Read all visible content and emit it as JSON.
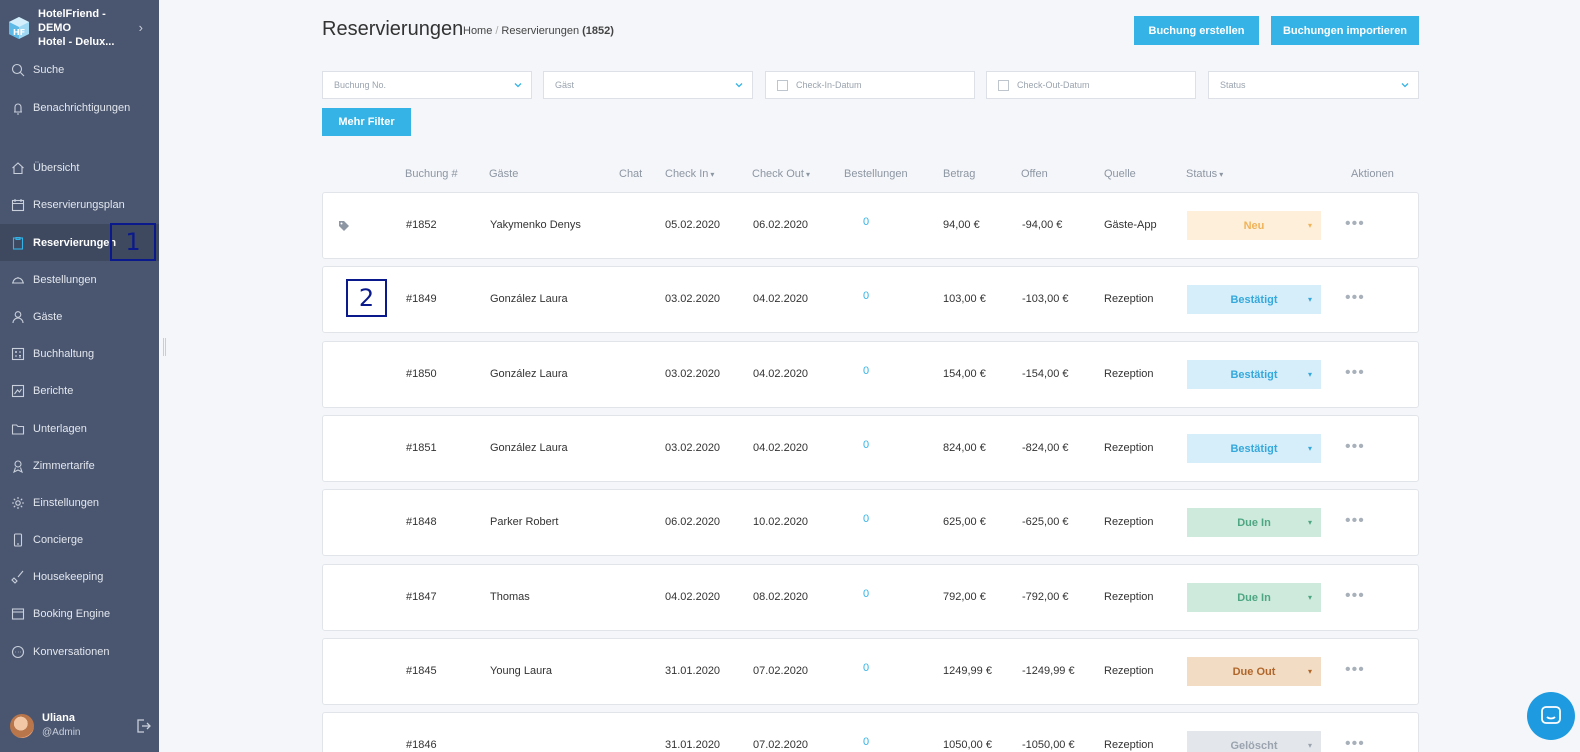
{
  "sidebar": {
    "hotel_line1": "HotelFriend - DEMO",
    "hotel_line2": "Hotel - Delux...",
    "items": [
      {
        "label": "Suche",
        "icon": "search-icon"
      },
      {
        "label": "Benachrichtigungen",
        "icon": "bell-icon"
      },
      {
        "label": "Übersicht",
        "icon": "home-icon"
      },
      {
        "label": "Reservierungsplan",
        "icon": "calendar-icon"
      },
      {
        "label": "Reservierungen",
        "icon": "clipboard-icon",
        "active": true
      },
      {
        "label": "Bestellungen",
        "icon": "cloche-icon"
      },
      {
        "label": "Gäste",
        "icon": "user-icon"
      },
      {
        "label": "Buchhaltung",
        "icon": "calculator-icon"
      },
      {
        "label": "Berichte",
        "icon": "chart-icon"
      },
      {
        "label": "Unterlagen",
        "icon": "folder-icon"
      },
      {
        "label": "Zimmertarife",
        "icon": "tariff-icon"
      },
      {
        "label": "Einstellungen",
        "icon": "gear-icon"
      },
      {
        "label": "Concierge",
        "icon": "phone-icon"
      },
      {
        "label": "Housekeeping",
        "icon": "broom-icon"
      },
      {
        "label": "Booking Engine",
        "icon": "browser-icon"
      },
      {
        "label": "Konversationen",
        "icon": "chat-icon"
      }
    ],
    "user": {
      "name": "Uliana",
      "role": "@Admin"
    }
  },
  "annotations": {
    "one": "1",
    "two": "2"
  },
  "header": {
    "title": "Reservierungen",
    "breadcrumb_home": "Home",
    "breadcrumb_current": "Reservierungen",
    "breadcrumb_count": "(1852)",
    "create_button": "Buchung erstellen",
    "import_button": "Buchungen importieren"
  },
  "filters": {
    "booking_no": "Buchung No.",
    "guest": "Gäst",
    "check_in": "Check-In-Datum",
    "check_out": "Check-Out-Datum",
    "status": "Status",
    "more_button": "Mehr Filter"
  },
  "table": {
    "columns": {
      "booking": "Buchung #",
      "guests": "Gäste",
      "chat": "Chat",
      "check_in": "Check In",
      "check_out": "Check Out",
      "orders": "Bestellungen",
      "amount": "Betrag",
      "open": "Offen",
      "source": "Quelle",
      "status": "Status",
      "actions": "Aktionen"
    },
    "rows": [
      {
        "booking": "#1852",
        "guest": "Yakymenko Denys",
        "check_in": "05.02.2020",
        "check_out": "06.02.2020",
        "orders": "0",
        "amount": "94,00 €",
        "open": "-94,00 €",
        "source": "Gäste-App",
        "status": "Neu",
        "tag": true
      },
      {
        "booking": "#1849",
        "guest": "González Laura",
        "check_in": "03.02.2020",
        "check_out": "04.02.2020",
        "orders": "0",
        "amount": "103,00 €",
        "open": "-103,00 €",
        "source": "Rezeption",
        "status": "Bestätigt"
      },
      {
        "booking": "#1850",
        "guest": "González Laura",
        "check_in": "03.02.2020",
        "check_out": "04.02.2020",
        "orders": "0",
        "amount": "154,00 €",
        "open": "-154,00 €",
        "source": "Rezeption",
        "status": "Bestätigt"
      },
      {
        "booking": "#1851",
        "guest": "González Laura",
        "check_in": "03.02.2020",
        "check_out": "04.02.2020",
        "orders": "0",
        "amount": "824,00 €",
        "open": "-824,00 €",
        "source": "Rezeption",
        "status": "Bestätigt"
      },
      {
        "booking": "#1848",
        "guest": "Parker Robert",
        "check_in": "06.02.2020",
        "check_out": "10.02.2020",
        "orders": "0",
        "amount": "625,00 €",
        "open": "-625,00 €",
        "source": "Rezeption",
        "status": "Due In"
      },
      {
        "booking": "#1847",
        "guest": "Thomas",
        "check_in": "04.02.2020",
        "check_out": "08.02.2020",
        "orders": "0",
        "amount": "792,00 €",
        "open": "-792,00 €",
        "source": "Rezeption",
        "status": "Due In"
      },
      {
        "booking": "#1845",
        "guest": "Young Laura",
        "check_in": "31.01.2020",
        "check_out": "07.02.2020",
        "orders": "0",
        "amount": "1249,99 €",
        "open": "-1249,99 €",
        "source": "Rezeption",
        "status": "Due Out"
      },
      {
        "booking": "#1846",
        "guest": "",
        "check_in": "31.01.2020",
        "check_out": "07.02.2020",
        "orders": "0",
        "amount": "1050,00 €",
        "open": "-1050,00 €",
        "source": "Rezeption",
        "status": "Gelöscht"
      }
    ]
  },
  "status_colors": {
    "Neu": {
      "bg": "#fdefd9",
      "fg": "#f0b35a"
    },
    "Bestätigt": {
      "bg": "#d6eef9",
      "fg": "#35a8dc"
    },
    "Due In": {
      "bg": "#cdeadd",
      "fg": "#4fa682"
    },
    "Due Out": {
      "bg": "#f3dcc4",
      "fg": "#b0662a"
    },
    "Gelöscht": {
      "bg": "#e3e7ec",
      "fg": "#9aa3ae"
    }
  },
  "accent_color": "#35b3e6"
}
